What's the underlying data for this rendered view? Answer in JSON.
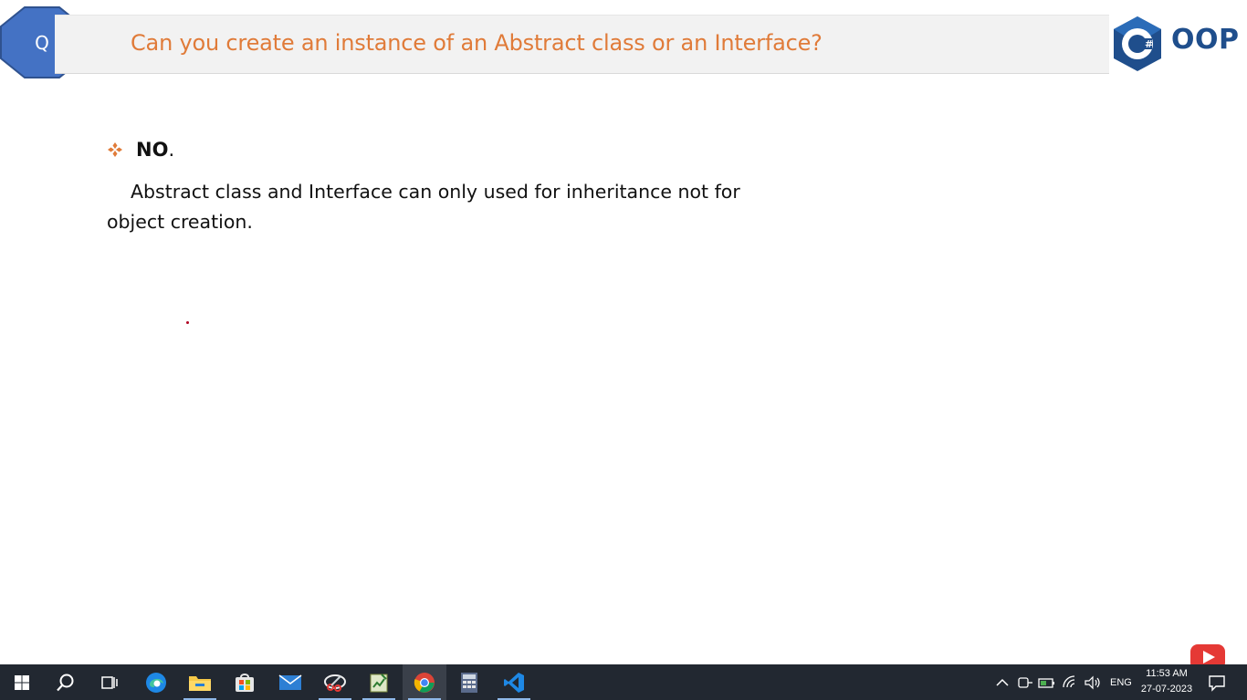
{
  "slide": {
    "badge_letter": "Q",
    "title": "Can you create an instance of an Abstract class or an Interface?",
    "logo_text": "OOP",
    "logo_symbol": "C#",
    "bullet": {
      "label": "NO",
      "suffix": "."
    },
    "body": "Abstract class and Interface can only used for inheritance not for object creation."
  },
  "colors": {
    "title": "#e07b39",
    "badge": "#4472c4",
    "logo": "#1f4e8c",
    "taskbar": "#222831"
  },
  "taskbar": {
    "items": [
      {
        "name": "start",
        "icon": "windows-icon"
      },
      {
        "name": "search",
        "icon": "search-icon"
      },
      {
        "name": "task-view",
        "icon": "task-view-icon"
      },
      {
        "name": "edge",
        "icon": "edge-icon"
      },
      {
        "name": "file-explorer",
        "icon": "folder-icon"
      },
      {
        "name": "store",
        "icon": "store-icon"
      },
      {
        "name": "mail",
        "icon": "mail-icon"
      },
      {
        "name": "snipping",
        "icon": "snipping-tool-icon"
      },
      {
        "name": "notepad",
        "icon": "notepad-icon"
      },
      {
        "name": "chrome",
        "icon": "chrome-icon"
      },
      {
        "name": "calculator",
        "icon": "calculator-icon"
      },
      {
        "name": "vscode",
        "icon": "vscode-icon"
      }
    ],
    "tray": {
      "language": "ENG",
      "time": "11:53 AM",
      "date": "27-07-2023"
    }
  }
}
